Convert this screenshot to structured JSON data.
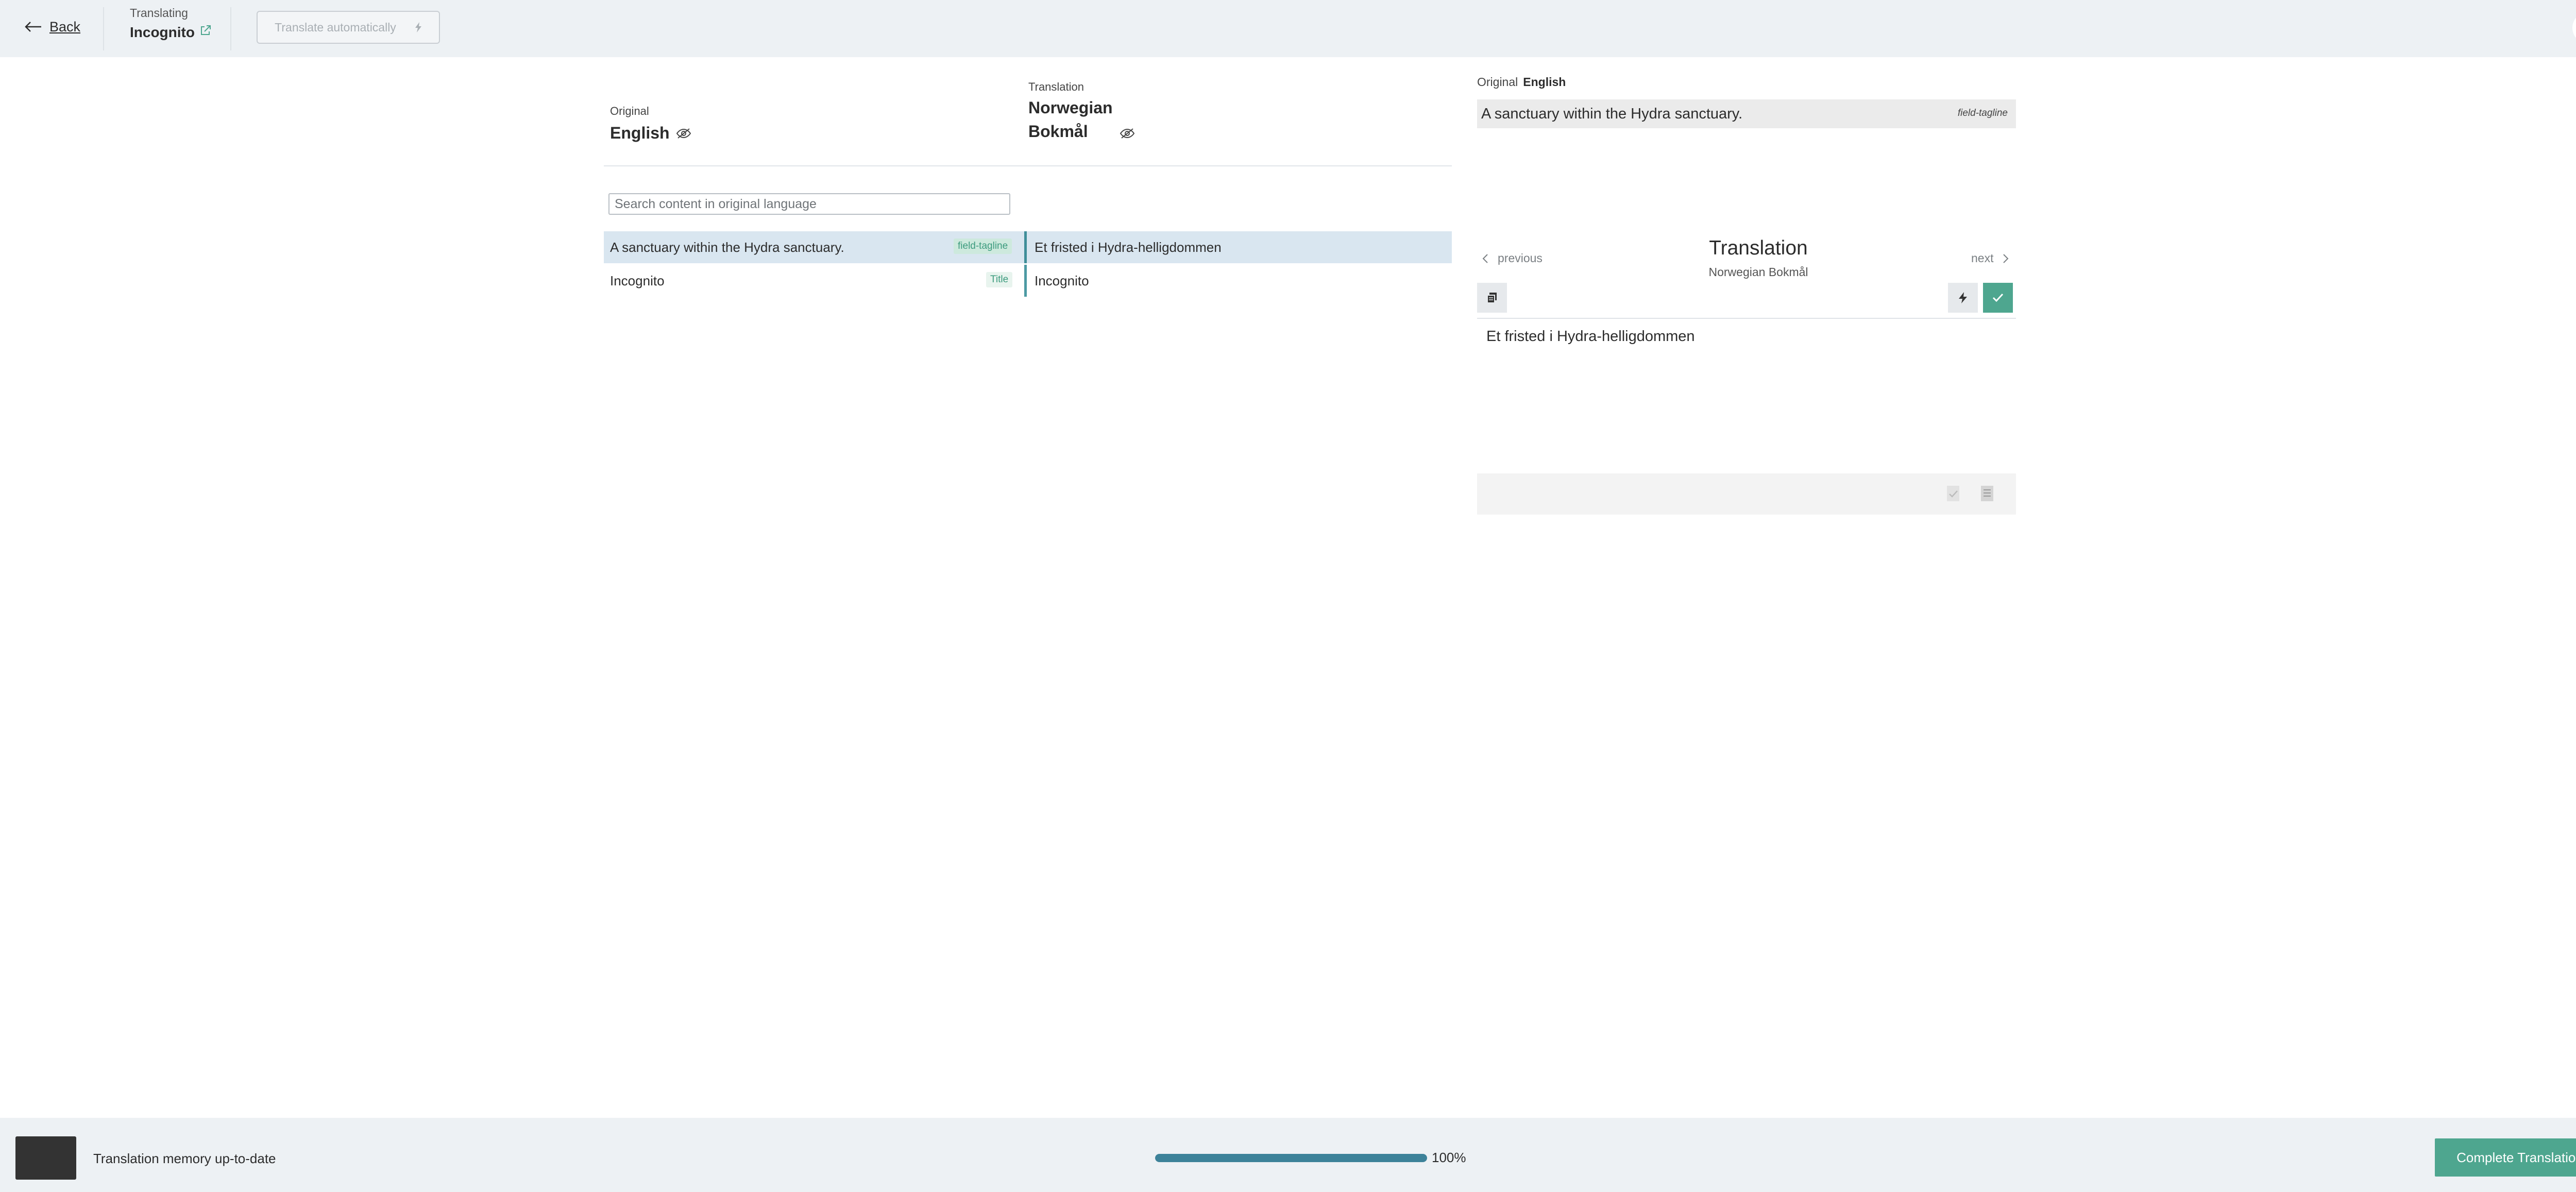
{
  "header": {
    "back_label": "Back",
    "translating_label": "Translating",
    "document_name": "Incognito",
    "translate_auto_label": "Translate automatically"
  },
  "list": {
    "original_label": "Original",
    "original_language": "English",
    "translation_label": "Translation",
    "translation_language_line1": "Norwegian",
    "translation_language_line2": "Bokmål",
    "search_placeholder": "Search content in original language",
    "rows": [
      {
        "source": "A sanctuary within the Hydra sanctuary.",
        "tag": "field-tagline",
        "target": "Et fristed i Hydra-helligdommen"
      },
      {
        "source": "Incognito",
        "tag": "Title",
        "target": "Incognito"
      }
    ]
  },
  "panel": {
    "original_label": "Original",
    "original_language": "English",
    "original_text": "A sanctuary within the Hydra sanctuary.",
    "field_name": "field-tagline",
    "previous_label": "previous",
    "next_label": "next",
    "title": "Translation",
    "language": "Norwegian Bokmål",
    "editor_text": "Et fristed i Hydra-helligdommen"
  },
  "footer": {
    "tm_status": "Translation memory up-to-date",
    "progress_percent": 100,
    "progress_label": "100%",
    "complete_label": "Complete Translation"
  },
  "colors": {
    "accent_green": "#4ea68f",
    "progress_fill": "#3d8299",
    "selected_row": "#d9e6f0",
    "bar_background": "#edf1f4"
  },
  "icons": [
    "arrow-left-icon",
    "external-link-icon",
    "lightning-icon",
    "gear-icon",
    "eye-slash-icon",
    "chevron-left-icon",
    "chevron-right-icon",
    "copy-icon",
    "check-icon",
    "checkmark-doc-icon",
    "text-doc-icon"
  ]
}
